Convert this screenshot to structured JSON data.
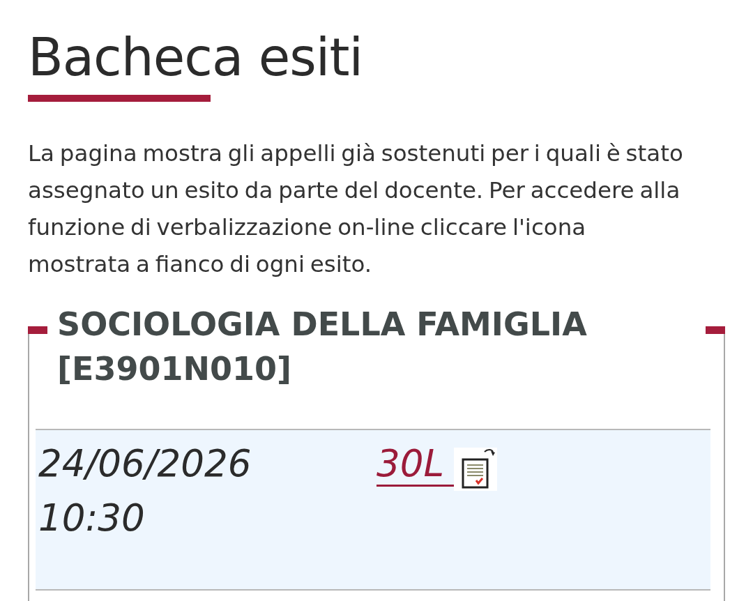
{
  "page": {
    "title": "Bacheca esiti",
    "description": "La pagina mostra gli appelli già sostenuti per i quali è stato assegnato un esito da parte del docente. Per accedere alla funzione di verbalizzazione on-line cliccare l'icona mostrata a fianco di ogni esito."
  },
  "courses": [
    {
      "title": "SOCIOLOGIA DELLA FAMIGLIA [E3901N010]",
      "results": [
        {
          "date": "24/06/2026",
          "time": "10:30",
          "grade": "30L"
        }
      ]
    }
  ]
}
